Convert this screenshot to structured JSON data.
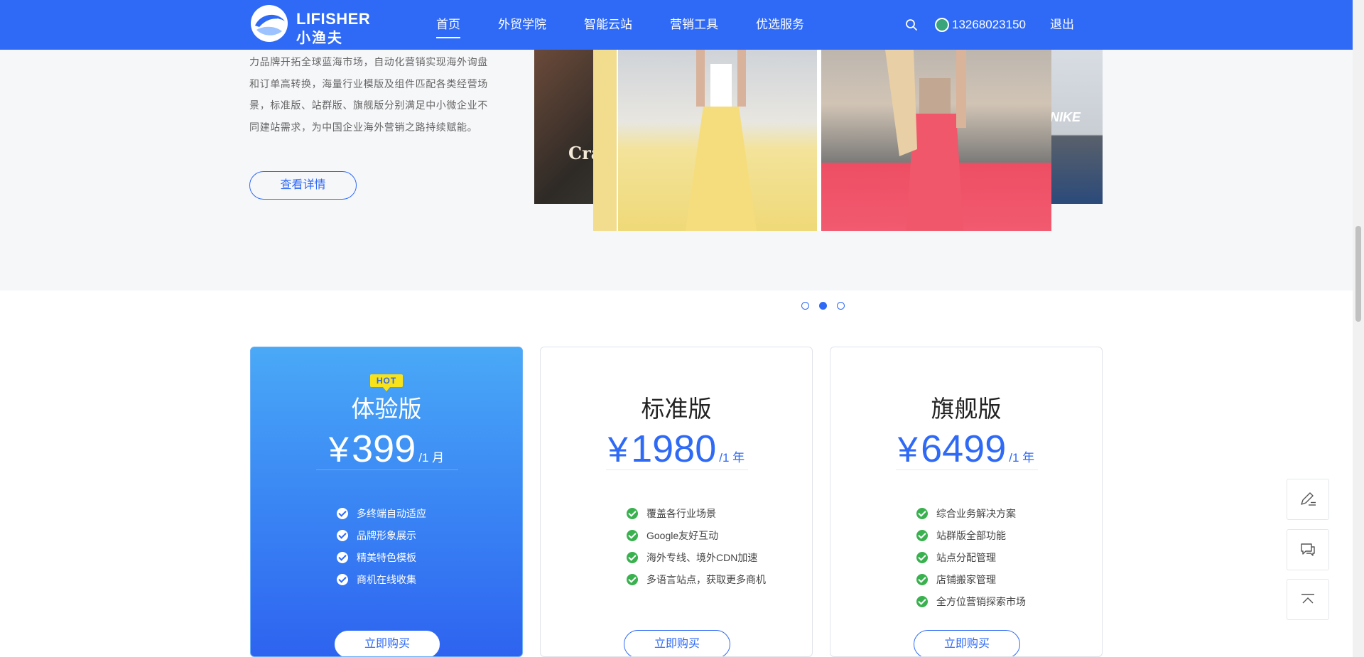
{
  "header": {
    "logo_en": "LIFISHER",
    "logo_cn": "小渔夫",
    "nav": [
      {
        "label": "首页",
        "active": true
      },
      {
        "label": "外贸学院",
        "active": false
      },
      {
        "label": "智能云站",
        "active": false
      },
      {
        "label": "营销工具",
        "active": false
      },
      {
        "label": "优选服务",
        "active": false
      }
    ],
    "phone": "13268023150",
    "logout": "退出"
  },
  "hero": {
    "description_lines": [
      "力品牌开拓全球蓝海市场，自动化营销实现海外询盘",
      "和订单高转换，海量行业模版及组件匹配各类经营场",
      "景，标准版、站群版、旗舰版分别满足中小微企业不",
      "同建站需求，为中国企业海外营销之路持续赋能。"
    ],
    "detail_button": "查看详情",
    "carousel": {
      "slide_count": 3,
      "active_index": 1,
      "left_slide_text": "Cra",
      "right_slide_text": "NIKE"
    }
  },
  "plans": [
    {
      "name": "体验版",
      "badge": "HOT",
      "currency": "¥",
      "price": "399",
      "unit": "/1 月",
      "featured": true,
      "features": [
        "多终端自动适应",
        "品牌形象展示",
        "精美特色模板",
        "商机在线收集"
      ],
      "button": "立即购买"
    },
    {
      "name": "标准版",
      "badge": "",
      "currency": "¥",
      "price": "1980",
      "unit": "/1 年",
      "featured": false,
      "features": [
        "覆盖各行业场景",
        "Google友好互动",
        "海外专线、境外CDN加速",
        "多语言站点，获取更多商机"
      ],
      "button": "立即购买"
    },
    {
      "name": "旗舰版",
      "badge": "",
      "currency": "¥",
      "price": "6499",
      "unit": "/1 年",
      "featured": false,
      "features": [
        "综合业务解决方案",
        "站群版全部功能",
        "站点分配管理",
        "店铺搬家管理",
        "全方位营销探索市场"
      ],
      "button": "立即购买"
    }
  ],
  "side_tools": [
    {
      "icon": "edit-icon"
    },
    {
      "icon": "chat-icon"
    },
    {
      "icon": "back-to-top-icon"
    }
  ],
  "colors": {
    "brand": "#2f6af6",
    "check": "#3ab14f",
    "hot_badge": "#f8e21a"
  }
}
